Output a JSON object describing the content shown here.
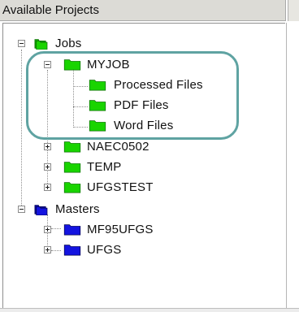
{
  "header": {
    "title": "Available Projects"
  },
  "tree": {
    "jobs": {
      "label": "Jobs",
      "myjob": {
        "label": "MYJOB",
        "children": [
          "Processed Files",
          "PDF Files",
          "Word Files"
        ]
      },
      "others": [
        "NAEC0502",
        "TEMP",
        "UFGSTEST"
      ]
    },
    "masters": {
      "label": "Masters",
      "children": [
        "MF95UFGS",
        "UFGS"
      ]
    }
  },
  "colors": {
    "folder_green": "#19d400",
    "folder_blue": "#1414e0",
    "highlight": "#5fa3a2"
  },
  "icons": {
    "folder": "folder-icon",
    "expand": "expand-plus-icon",
    "collapse": "collapse-minus-icon"
  }
}
